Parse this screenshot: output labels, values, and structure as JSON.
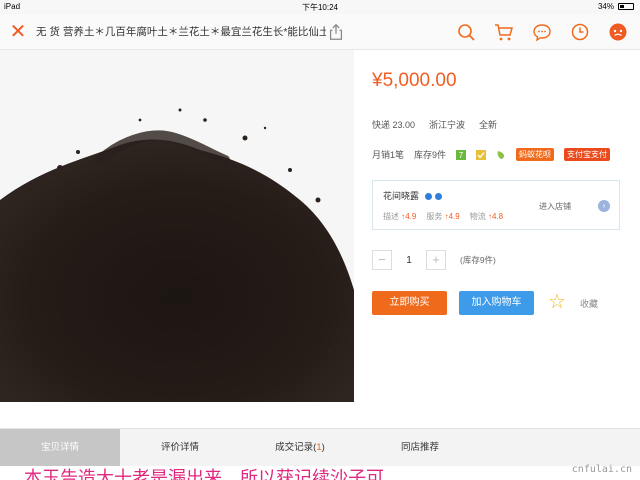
{
  "status_bar": {
    "device": "iPad",
    "time": "下午10:24",
    "battery": "34%"
  },
  "navbar": {
    "title": "无 货 营养土＊几百年腐叶土＊兰花土＊最宜兰花生长*能比仙土",
    "icons": [
      "close-icon",
      "share-icon",
      "search-icon",
      "cart-icon",
      "message-icon",
      "clock-icon",
      "profile-icon"
    ]
  },
  "product": {
    "price": "¥5,000.00",
    "shipping_fee": "快递 23.00",
    "location": "浙江宁波",
    "condition": "全新",
    "monthly_sales": "月销1笔",
    "stock": "库存9件",
    "tag_huabei": "蚂蚁花呗",
    "tag_alipay": "支付宝支付"
  },
  "shop": {
    "name": "花间晓露",
    "desc_label": "描述",
    "desc_value": "↑4.9",
    "service_label": "服务",
    "service_value": "↑4.9",
    "logistics_label": "物流",
    "logistics_value": "↑4.8",
    "enter_label": "进入店铺"
  },
  "quantity": {
    "minus": "−",
    "value": "1",
    "plus": "+",
    "stock_note": "(库存9件)"
  },
  "actions": {
    "buy_now": "立即购买",
    "add_cart": "加入购物车",
    "favorite": "收藏"
  },
  "tabs": [
    {
      "label": "宝贝详情"
    },
    {
      "label": "评价详情"
    },
    {
      "label": "成交记录(",
      "count": "1",
      "suffix": ")"
    },
    {
      "label": "同店推荐"
    }
  ],
  "caption": "本玉告造大十老是漏出来，所以获记续沙子可",
  "watermark": "cnfulai.cn",
  "colors": {
    "accent": "#f06a1c",
    "price": "#f25d22",
    "cart_button": "#3d9be9"
  }
}
